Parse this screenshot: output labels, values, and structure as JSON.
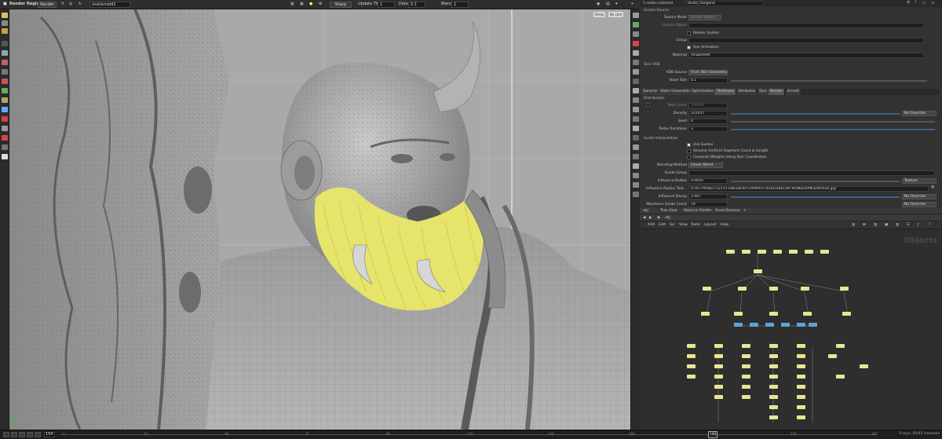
{
  "toolbar": {
    "title": "Render Region",
    "render_label": "Render",
    "camera_path": "/out/arnold1",
    "sharp_label": "Sharp",
    "update_time_label": "Update Time",
    "update_time_value": "1",
    "delay_label": "Delay",
    "delay_value": "0.1",
    "blend_label": "Blend",
    "blend_value": "1"
  },
  "viewport": {
    "persp_label": "Persp",
    "camera_label": "No cam"
  },
  "params_header": {
    "selection": "5 nodes selected",
    "node_name": "HEAD_hairgen4"
  },
  "groom_source": {
    "title": "Groom Source",
    "source_mode_label": "Source Mode",
    "source_mode_value": "Groom Object",
    "groom_object_label": "Groom Object",
    "render_guides_label": "Render Guides",
    "group_label": "Group",
    "use_animation_label": "Use Animation",
    "material_label": "Material",
    "material_value": "/shop/HAIR"
  },
  "skin_vdb": {
    "title": "Skin VDB",
    "vdb_source_label": "VDB Source",
    "vdb_source_value": "From Skin Geometry",
    "voxel_size_label": "Voxel Size",
    "voxel_size_value": "0.1"
  },
  "tabs": [
    "General",
    "Static Generation",
    "Optimization",
    "Thickness",
    "Attributes",
    "Skin",
    "Render",
    "Arnold"
  ],
  "distribution": {
    "title": "Distribution",
    "total_count_label": "Total Count",
    "total_count_value": "100000",
    "density_label": "Density",
    "density_value": "222057",
    "density_override": "No Override",
    "seed_label": "Seed",
    "seed_value": "0",
    "relax_label": "Relax Iterations",
    "relax_value": "3"
  },
  "guide_interp": {
    "title": "Guide Interpolation",
    "use_guides_label": "Use Guides",
    "assume_uniform_label": "Assume Uniform Segment Count & Length",
    "compute_weights_label": "Compute Weights Using Skin Coordinates",
    "blending_method_label": "Blending Method",
    "blending_method_value": "Linear Blend",
    "guide_group_label": "Guide Group",
    "influence_radius_label": "Influence Radius",
    "influence_radius_value": "0.0050",
    "influence_radius_override": "Texture",
    "influence_radius_texture_label": "Influence Radius Text...",
    "influence_radius_texture_value": "D:/01-PROJECTS/115-LIBELBOOTCAMP/03-OGRELIBEL/09-RENDER/MESH/h/h5h.jpg",
    "influence_decay_label": "Influence Decay",
    "influence_decay_value": "2.947",
    "influence_decay_override": "No Override",
    "max_guide_count_label": "Maximum Guide Count",
    "max_guide_count_value": "19",
    "max_guide_count_override": "No Override"
  },
  "network": {
    "path": "obj",
    "tabs": [
      "Tree View",
      "Material Palette",
      "Asset Browser"
    ],
    "menu": [
      "Add",
      "Edit",
      "Go",
      "View",
      "Tools",
      "Layout",
      "Help"
    ],
    "context_label": "Objects",
    "path_label": "obj"
  },
  "timeline": {
    "current_frame": "194",
    "ticks": [
      "1",
      "24",
      "48",
      "72",
      "96",
      "120",
      "144",
      "168",
      "194",
      "216",
      "240"
    ],
    "status": "0 keys, 45/45 channels"
  },
  "colors": {
    "hair": "#e6e46a",
    "viewport_bg": "#a7a7a7",
    "node_yellow": "#e8e592",
    "node_blue": "#5fa3d6",
    "node_teal": "#7cc4c4"
  }
}
